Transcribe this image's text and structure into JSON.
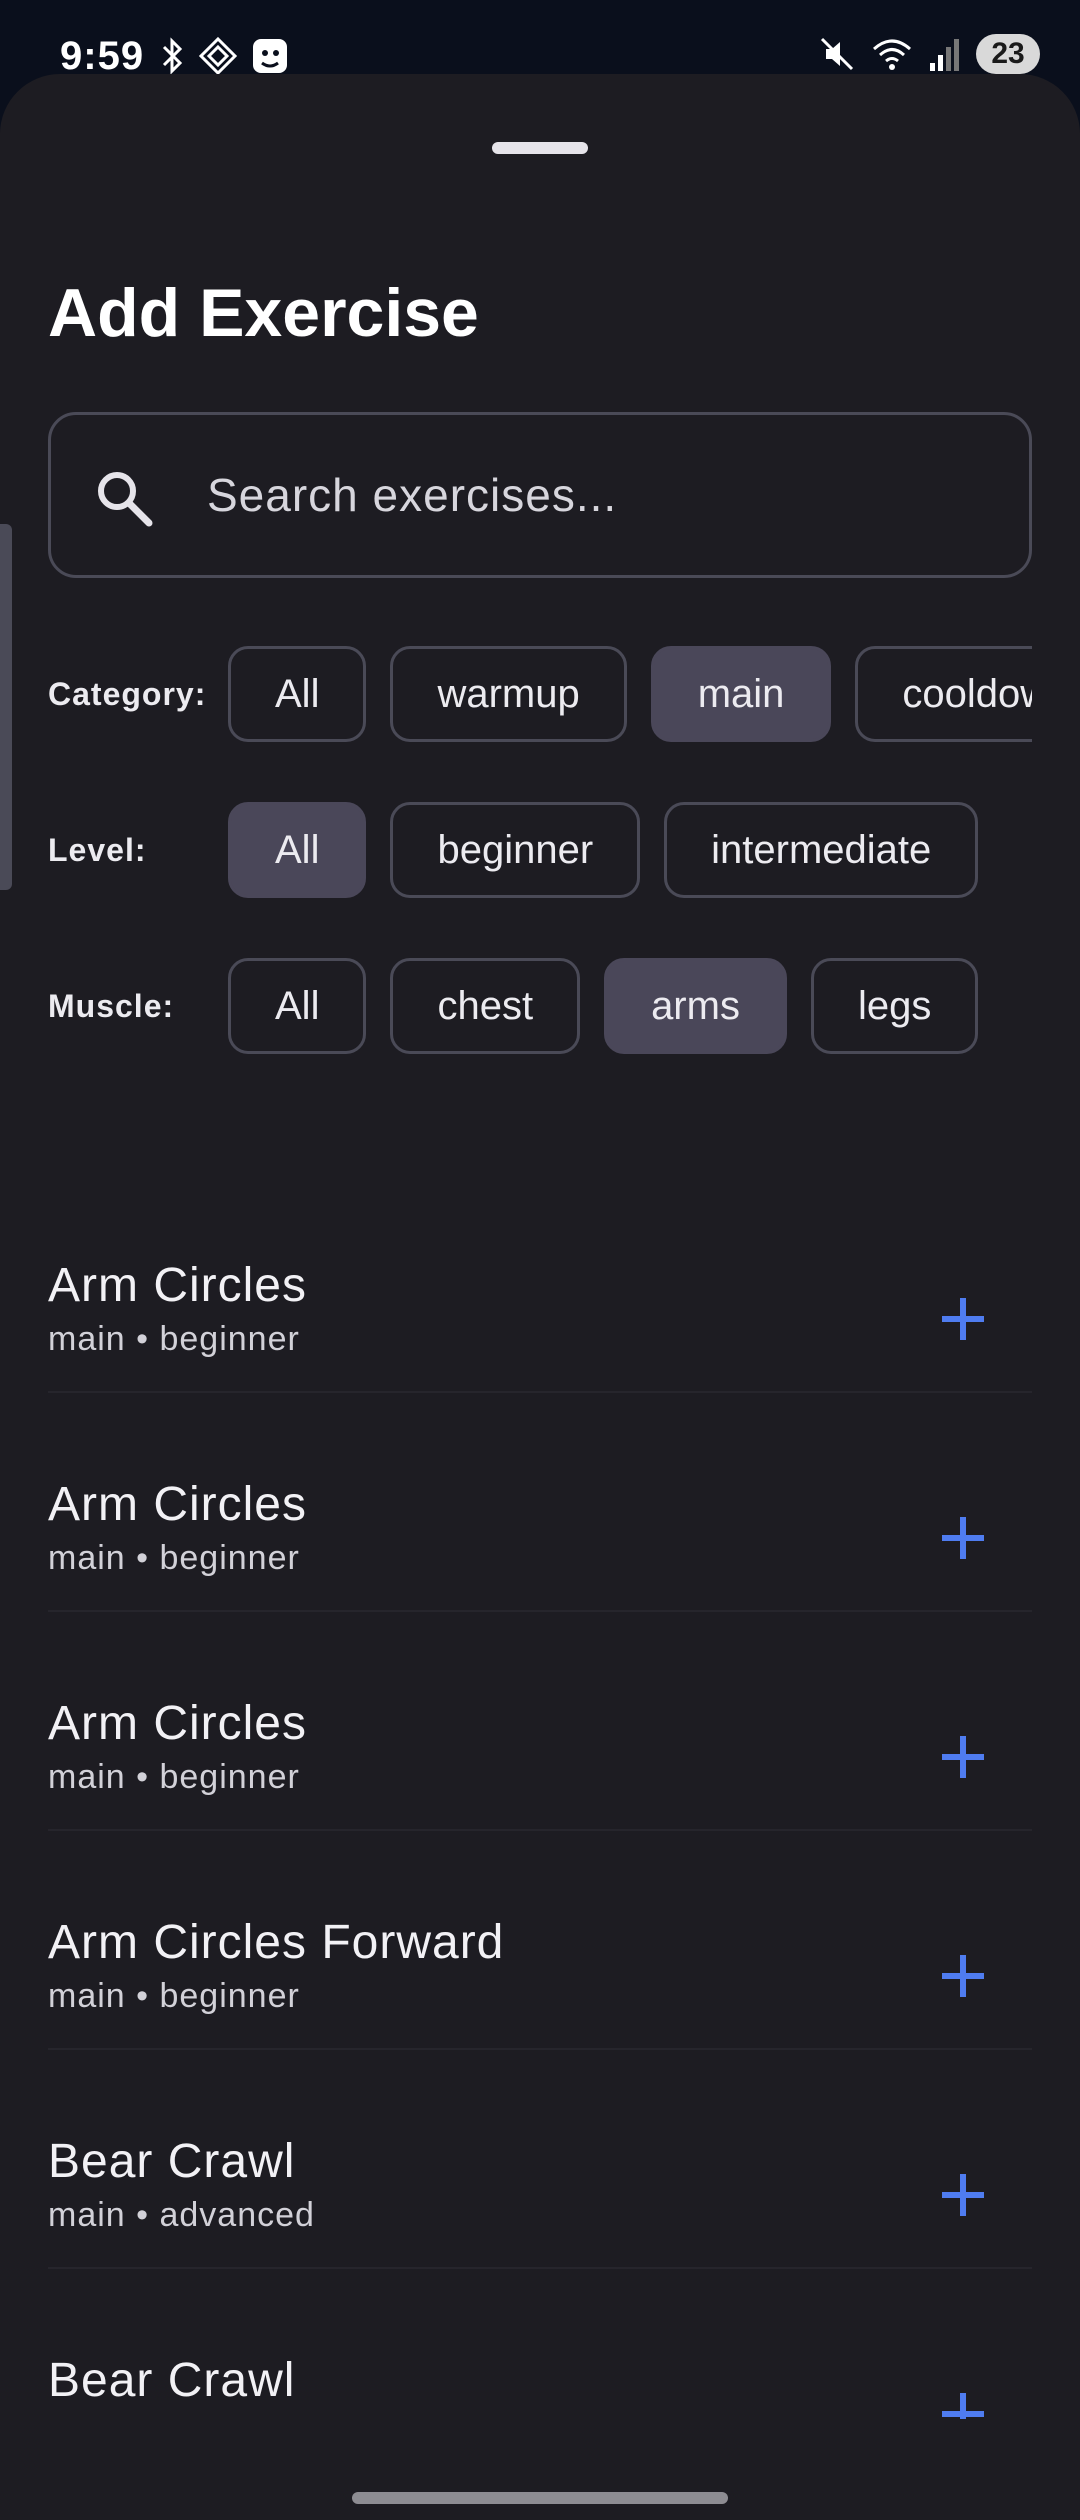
{
  "status_bar": {
    "time": "9:59",
    "battery": "23"
  },
  "sheet": {
    "title": "Add Exercise"
  },
  "search": {
    "placeholder": "Search exercises..."
  },
  "filters": {
    "category": {
      "label": "Category:",
      "options": [
        "All",
        "warmup",
        "main",
        "cooldown"
      ],
      "selected": "main"
    },
    "level": {
      "label": "Level:",
      "options": [
        "All",
        "beginner",
        "intermediate"
      ],
      "selected": "All"
    },
    "muscle": {
      "label": "Muscle:",
      "options": [
        "All",
        "chest",
        "arms",
        "legs"
      ],
      "selected": "arms"
    }
  },
  "exercises": [
    {
      "name": "Arm Circles",
      "meta": "main • beginner"
    },
    {
      "name": "Arm Circles",
      "meta": "main • beginner"
    },
    {
      "name": "Arm Circles",
      "meta": "main • beginner"
    },
    {
      "name": "Arm Circles Forward",
      "meta": "main • beginner"
    },
    {
      "name": "Bear Crawl",
      "meta": "main • advanced"
    },
    {
      "name": "Bear Crawl",
      "meta": ""
    }
  ],
  "colors": {
    "accent": "#4f7cf0",
    "sheet_bg": "#1d1c22",
    "chip_selected": "#4a4759"
  }
}
